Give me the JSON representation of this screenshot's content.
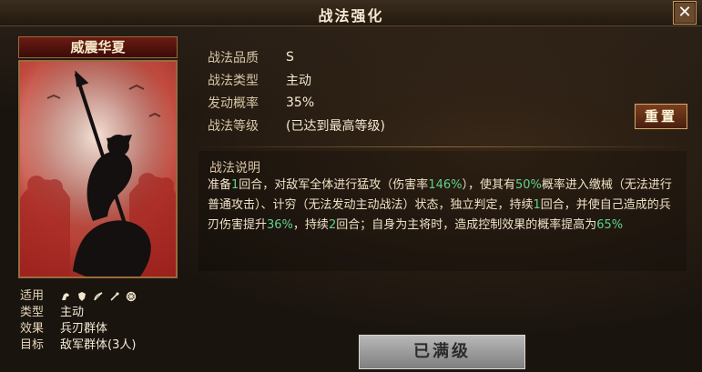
{
  "window": {
    "title": "战法强化"
  },
  "card": {
    "name": "威震华夏",
    "props": [
      {
        "key": "适用",
        "value": ""
      },
      {
        "key": "类型",
        "value": "主动"
      },
      {
        "key": "效果",
        "value": "兵刃群体"
      },
      {
        "key": "目标",
        "value": "敌军群体(3人)"
      }
    ],
    "applicable_icons": [
      "horse-icon",
      "shield-icon",
      "bow-icon",
      "spear-icon",
      "wheel-icon"
    ]
  },
  "info": {
    "quality_label": "战法品质",
    "quality_value": "S",
    "type_label": "战法类型",
    "type_value": "主动",
    "rate_label": "发动概率",
    "rate_value": "35%",
    "level_label": "战法等级",
    "level_value": "(已达到最高等级)"
  },
  "buttons": {
    "reset": "重置",
    "maxed": "已满级"
  },
  "description": {
    "title": "战法说明",
    "parts": [
      {
        "t": "准备"
      },
      {
        "t": "1",
        "hl": true
      },
      {
        "t": "回合，对敌军全体进行猛攻（伤害率"
      },
      {
        "t": "146%",
        "hl": true
      },
      {
        "t": "），使其有"
      },
      {
        "t": "50%",
        "hl": true
      },
      {
        "t": "概率进入缴械（无法进行普通攻击）、计穷（无法发动主动战法）状态，独立判定，持续"
      },
      {
        "t": "1",
        "hl": true
      },
      {
        "t": "回合，并使自己造成的兵刃伤害提升"
      },
      {
        "t": "36%",
        "hl": true
      },
      {
        "t": "，持续"
      },
      {
        "t": "2",
        "hl": true
      },
      {
        "t": "回合；自身为主将时，造成控制效果的概率提高为"
      },
      {
        "t": "65%",
        "hl": true
      }
    ]
  },
  "colors": {
    "highlight": "#5fd38c",
    "card_red": "#c24b3f"
  }
}
